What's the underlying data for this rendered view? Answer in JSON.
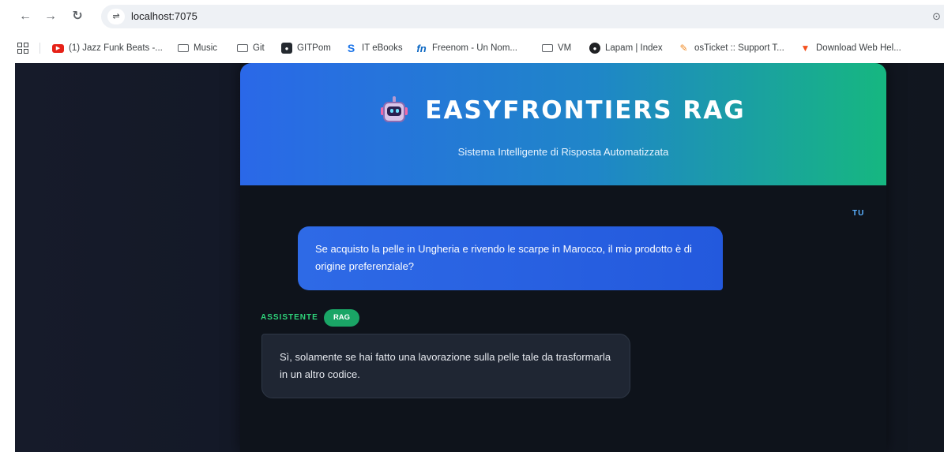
{
  "browser": {
    "url": "localhost:7075",
    "bookmarks": [
      {
        "label": "(1) Jazz Funk Beats -...",
        "icon": "youtube-icon"
      },
      {
        "label": "Music",
        "icon": "folder-icon"
      },
      {
        "label": "Git",
        "icon": "folder-icon"
      },
      {
        "label": "GITPom",
        "icon": "github-icon"
      },
      {
        "label": "IT eBooks",
        "icon": "s-icon"
      },
      {
        "label": "Freenom - Un Nom...",
        "icon": "fn-icon"
      },
      {
        "label": "VM",
        "icon": "folder-icon"
      },
      {
        "label": "Lapam | Index",
        "icon": "globe-icon"
      },
      {
        "label": "osTicket :: Support T...",
        "icon": "osticket-icon"
      },
      {
        "label": "Download Web Hel...",
        "icon": "download-icon"
      }
    ]
  },
  "app": {
    "title": "EASYFRONTIERS RAG",
    "subtitle": "Sistema Intelligente di Risposta Automatizzata",
    "brand_colors": {
      "gradient_start": "#2a68e8",
      "gradient_end": "#16b780"
    }
  },
  "chat": {
    "user_label": "TU",
    "user_message": "Se acquisto la pelle in Ungheria e rivendo le scarpe in Marocco, il mio prodotto è di origine preferenziale?",
    "assistant_label": "ASSISTENTE",
    "assistant_badge": "RAG",
    "assistant_message": "Sì, solamente se hai fatto una lavorazione sulla pelle tale da trasformarla in un altro codice."
  }
}
